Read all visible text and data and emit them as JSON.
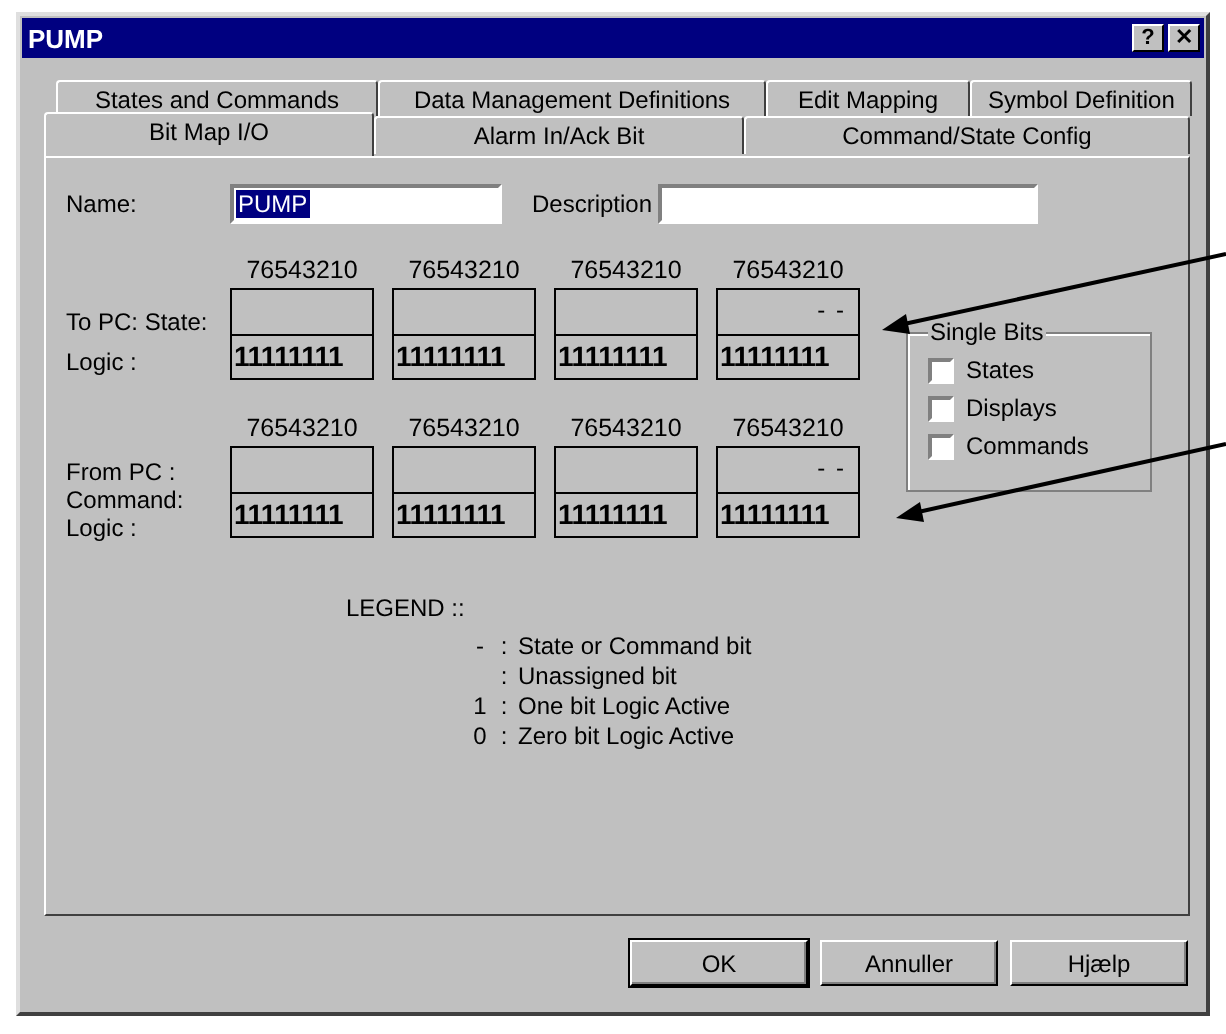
{
  "window": {
    "title": "PUMP",
    "controls": [
      "?",
      "✕"
    ]
  },
  "tabs": [
    [
      {
        "label": "States and Commands",
        "selected": false
      },
      {
        "label": "Data Management Definitions",
        "selected": false
      },
      {
        "label": "Edit Mapping",
        "selected": false
      },
      {
        "label": "Symbol Definition",
        "selected": false
      }
    ],
    [
      {
        "label": "Bit Map I/O",
        "selected": true
      },
      {
        "label": "Alarm In/Ack Bit",
        "selected": false
      },
      {
        "label": "Command/State Config",
        "selected": false
      }
    ]
  ],
  "name_field": {
    "label": "Name:",
    "value": "PUMP",
    "selected": true
  },
  "description_field": {
    "label": "Description"
  },
  "bit_groups": [
    {
      "labels": [
        "To PC: State:",
        "Logic :"
      ],
      "words": [
        {
          "header": "76543210",
          "logic": "11111111"
        },
        {
          "header": "76543210",
          "logic": "11111111"
        },
        {
          "header": "76543210",
          "logic": "11111111"
        },
        {
          "header": "76543210",
          "state": "- -",
          "logic": "11111111"
        }
      ]
    },
    {
      "labels": [
        "From PC :",
        "Command:",
        "Logic :"
      ],
      "words": [
        {
          "header": "76543210",
          "logic": "11111111"
        },
        {
          "header": "76543210",
          "logic": "11111111"
        },
        {
          "header": "76543210",
          "logic": "11111111"
        },
        {
          "header": "76543210",
          "state": "- -",
          "logic": "11111111"
        }
      ]
    }
  ],
  "single_bits": {
    "title": "Single Bits",
    "options": [
      {
        "label": "States",
        "checked": false
      },
      {
        "label": "Displays",
        "checked": false
      },
      {
        "label": "Commands",
        "checked": false
      }
    ]
  },
  "legend": {
    "title": "LEGEND ::",
    "entries": [
      {
        "symbol": "-",
        "separator": ":",
        "text": "State or Command bit"
      },
      {
        "separator": ":",
        "text": "Unassigned bit"
      },
      {
        "symbol": "1",
        "separator": ":",
        "text": "One bit Logic Active"
      },
      {
        "symbol": "0",
        "separator": ":",
        "text": "Zero bit Logic Active"
      }
    ]
  },
  "buttons": [
    {
      "label": "OK",
      "default": true
    },
    {
      "label": "Annuller",
      "default": false
    },
    {
      "label": "Hjælp",
      "default": false
    }
  ]
}
